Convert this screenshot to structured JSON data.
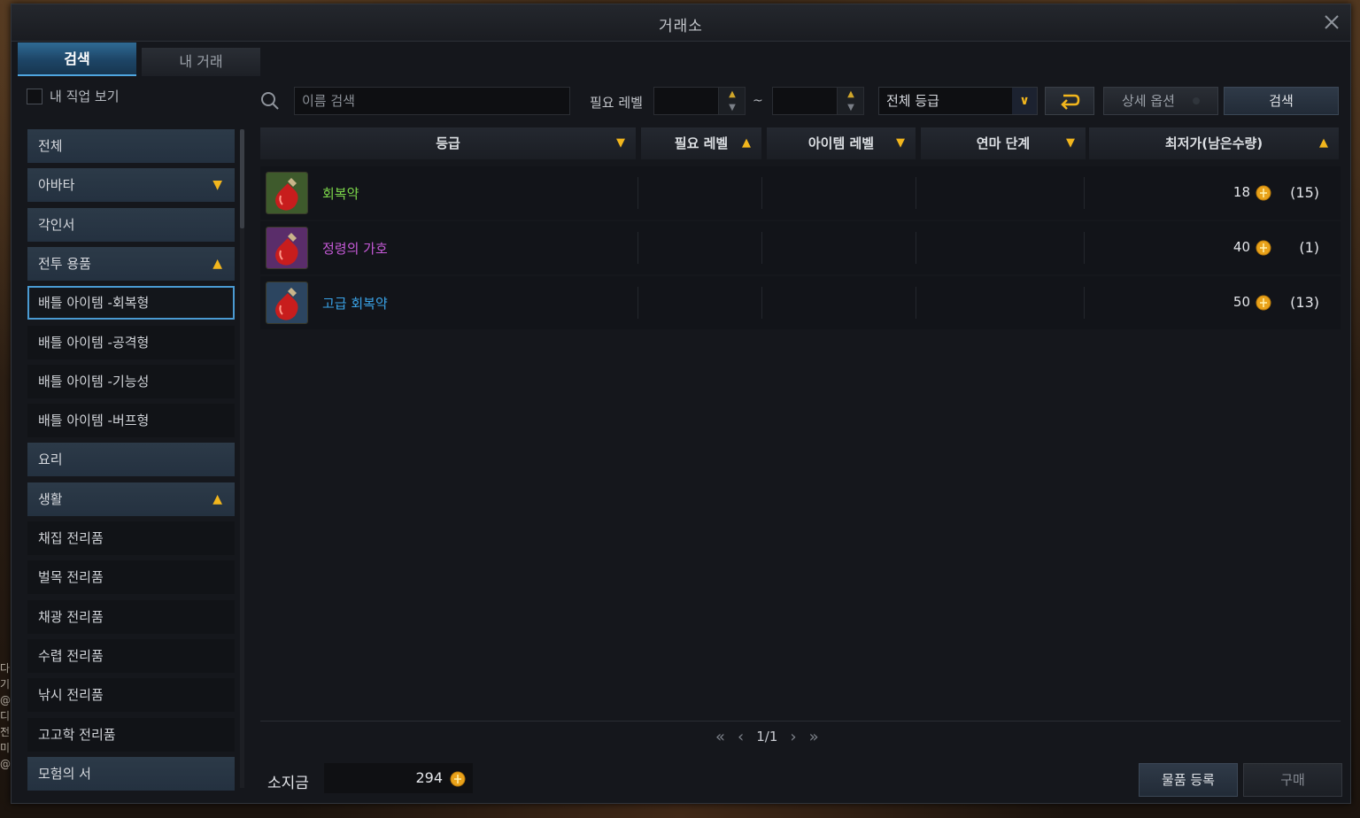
{
  "window": {
    "title": "거래소"
  },
  "tabs": [
    {
      "label": "검색",
      "active": true
    },
    {
      "label": "내 거래",
      "active": false
    }
  ],
  "filters": {
    "my_class_label": "내 직업 보기",
    "my_class_checked": false,
    "search_placeholder": "이름 검색",
    "level_label": "필요 레벨",
    "range_separator": "~",
    "grade_value": "전체 등급",
    "detail_options_label": "상세 옵션",
    "search_button_label": "검색"
  },
  "sidebar": {
    "items": [
      {
        "label": "전체",
        "type": "header"
      },
      {
        "label": "아바타",
        "type": "header",
        "caret": "down"
      },
      {
        "label": "각인서",
        "type": "header"
      },
      {
        "label": "전투 용품",
        "type": "header",
        "caret": "up"
      },
      {
        "label": "배틀 아이템 -회복형",
        "type": "sub",
        "selected": true
      },
      {
        "label": "배틀 아이템 -공격형",
        "type": "sub"
      },
      {
        "label": "배틀 아이템 -기능성",
        "type": "sub"
      },
      {
        "label": "배틀 아이템 -버프형",
        "type": "sub"
      },
      {
        "label": "요리",
        "type": "header"
      },
      {
        "label": "생활",
        "type": "header",
        "caret": "up"
      },
      {
        "label": "채집 전리품",
        "type": "sub"
      },
      {
        "label": "벌목 전리품",
        "type": "sub"
      },
      {
        "label": "채광 전리품",
        "type": "sub"
      },
      {
        "label": "수렵 전리품",
        "type": "sub"
      },
      {
        "label": "낚시 전리품",
        "type": "sub"
      },
      {
        "label": "고고학 전리품",
        "type": "sub"
      },
      {
        "label": "모험의 서",
        "type": "header"
      }
    ]
  },
  "table": {
    "columns": [
      {
        "label": "등급",
        "sort": "down"
      },
      {
        "label": "필요 레벨",
        "sort": "up"
      },
      {
        "label": "아이템 레벨",
        "sort": "down"
      },
      {
        "label": "연마 단계",
        "sort": "down"
      },
      {
        "label": "최저가(남은수량)",
        "sort": "up"
      }
    ],
    "rows": [
      {
        "name": "회복약",
        "name_color": "#7cd64a",
        "icon_bg": "#3e5a2c",
        "price": "18",
        "qty": "(15)"
      },
      {
        "name": "정령의 가호",
        "name_color": "#c65ad8",
        "icon_bg": "#5a2d6a",
        "price": "40",
        "qty": "(1)"
      },
      {
        "name": "고급 회복약",
        "name_color": "#3aa3e8",
        "icon_bg": "#2c4560",
        "price": "50",
        "qty": "(13)"
      }
    ]
  },
  "pager": {
    "page": "1/1"
  },
  "footer": {
    "gold_label": "소지금",
    "gold_value": "294",
    "register_label": "물품 등록",
    "buy_label": "구매"
  },
  "colors": {
    "accent_gold": "#f2b61d",
    "tab_active": "#1d4566",
    "selected_border": "#4a9ad2"
  }
}
